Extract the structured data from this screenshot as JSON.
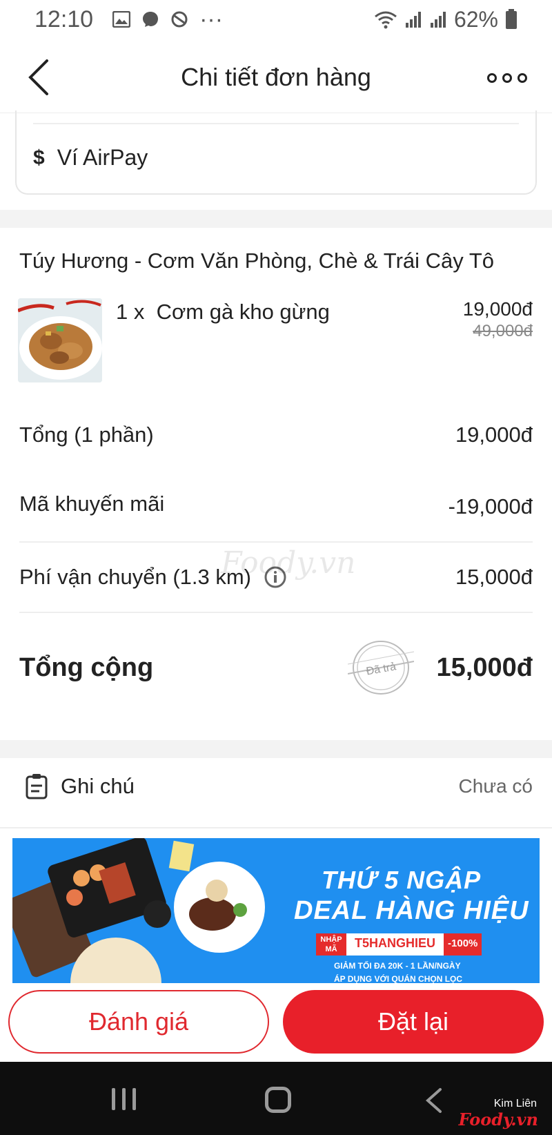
{
  "status_bar": {
    "time": "12:10",
    "battery": "62%"
  },
  "header": {
    "title": "Chi tiết đơn hàng"
  },
  "payment": {
    "method": "Ví AirPay",
    "icon": "$"
  },
  "restaurant": {
    "name": "Túy Hương - Cơm Văn Phòng, Chè & Trái Cây Tô"
  },
  "item": {
    "quantity": "1 x",
    "name": "Cơm gà kho gừng",
    "price": "19,000đ",
    "original_price": "49,000đ"
  },
  "summary": {
    "subtotal_label": "Tổng (1 phần)",
    "subtotal_value": "19,000đ",
    "promo_label": "Mã khuyến mãi",
    "promo_value": "-19,000đ",
    "shipping_label": "Phí vận chuyển (1.3 km)",
    "shipping_value": "15,000đ",
    "total_label": "Tổng cộng",
    "total_value": "15,000đ",
    "paid_stamp": "Đã trả"
  },
  "note": {
    "label": "Ghi chú",
    "value": "Chưa có"
  },
  "banner": {
    "line1": "THỨ 5 NGẬP",
    "line2": "DEAL HÀNG HIỆU",
    "code_tag": "NHẬP MÃ",
    "code": "T5HANGHIEU",
    "discount": "-100%",
    "fine1": "GIẢM TỐI ĐA 20K - 1 LẦN/NGÀY",
    "fine2": "ÁP DỤNG VỚI QUÁN CHỌN LỌC"
  },
  "actions": {
    "rate": "Đánh giá",
    "reorder": "Đặt lại"
  },
  "watermark": {
    "brand": "Foody.vn",
    "location": "Kim Liên",
    "logo": "Foody.vn"
  },
  "colors": {
    "accent": "#e8202a",
    "banner": "#1f8ff0",
    "navbar": "#0e0e0e"
  }
}
